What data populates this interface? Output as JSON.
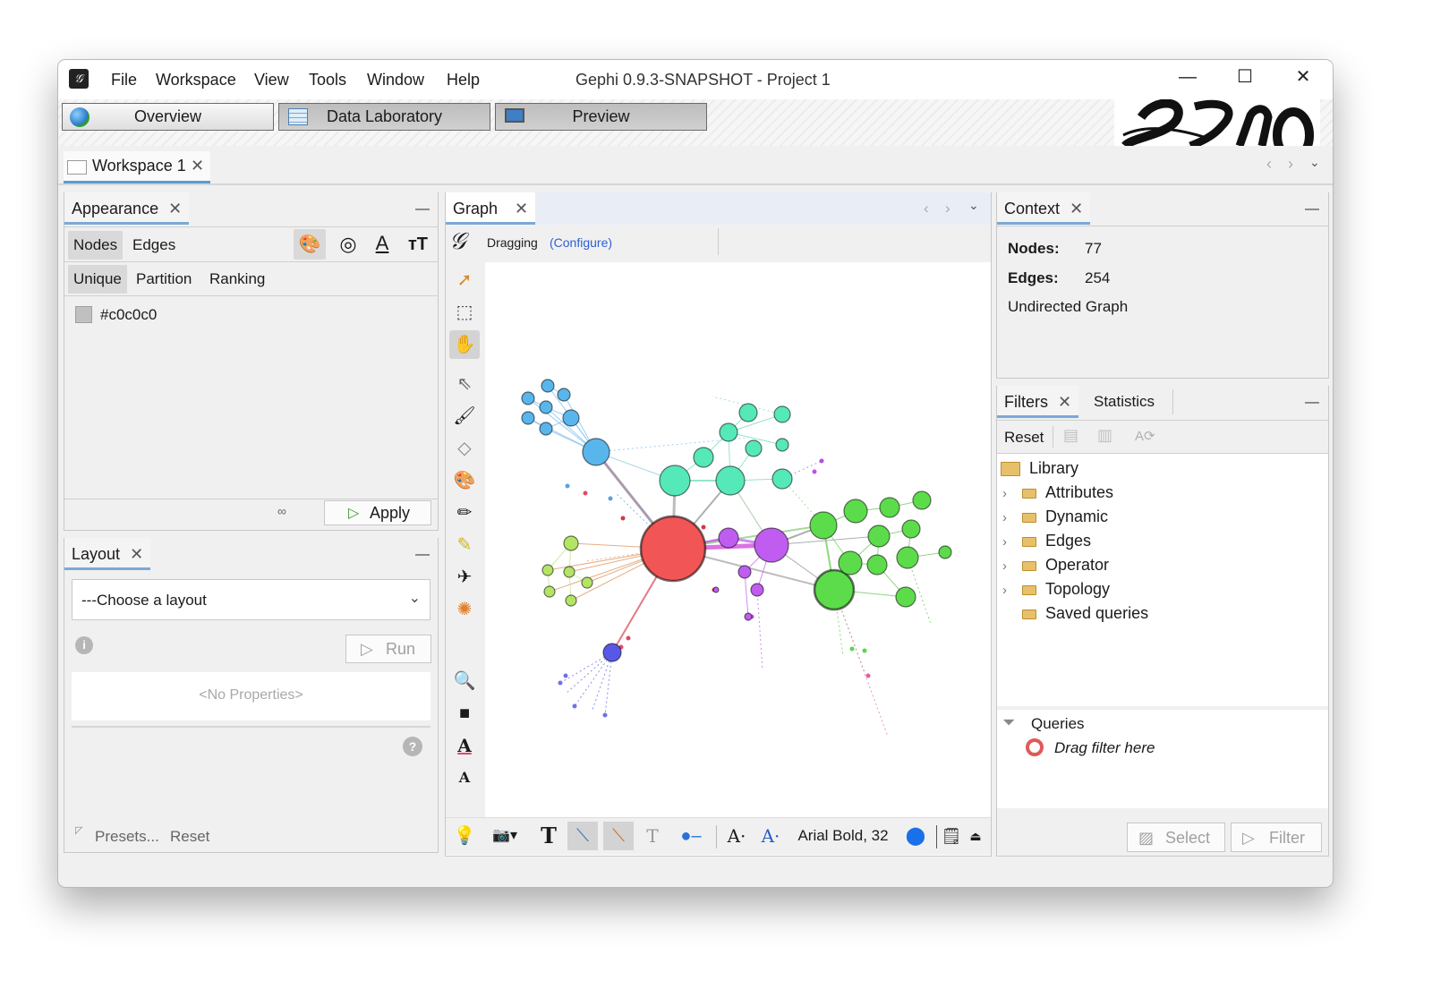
{
  "window": {
    "title": "Gephi 0.9.3-SNAPSHOT - Project 1",
    "menu": [
      "File",
      "Workspace",
      "View",
      "Tools",
      "Window",
      "Help"
    ],
    "controls": {
      "minimize": "—",
      "maximize": "☐",
      "close": "✕"
    }
  },
  "perspectives": [
    {
      "label": "Overview",
      "icon": "globe-icon",
      "selected": true
    },
    {
      "label": "Data Laboratory",
      "icon": "table-icon",
      "selected": false
    },
    {
      "label": "Preview",
      "icon": "monitor-icon",
      "selected": false
    }
  ],
  "workspace_tab": {
    "label": "Workspace 1",
    "close": "✕"
  },
  "appearance": {
    "title": "Appearance",
    "close": "✕",
    "element_tabs": [
      "Nodes",
      "Edges"
    ],
    "mode_tabs": [
      "Unique",
      "Partition",
      "Ranking"
    ],
    "color_value": "#c0c0c0",
    "apply_label": "Apply",
    "chain_icon": "∞"
  },
  "layout": {
    "title": "Layout",
    "close": "✕",
    "select_value": "---Choose a layout",
    "run_label": "Run",
    "no_properties": "<No Properties>",
    "presets_label": "Presets...",
    "reset_label": "Reset"
  },
  "graph": {
    "tab_label": "Graph",
    "close": "✕",
    "mode_label": "Dragging",
    "configure_link": "(Configure)",
    "font_label": "Arial Bold, 32",
    "edge_color": "#b0b0b0"
  },
  "context": {
    "title": "Context",
    "close": "✕",
    "nodes_label": "Nodes:",
    "nodes_value": "77",
    "edges_label": "Edges:",
    "edges_value": "254",
    "graph_type": "Undirected Graph"
  },
  "filters": {
    "tab_label": "Filters",
    "close": "✕",
    "statistics_tab": "Statistics",
    "reset_label": "Reset",
    "library_label": "Library",
    "library_items": [
      {
        "label": "Attributes",
        "expandable": true
      },
      {
        "label": "Dynamic",
        "expandable": true
      },
      {
        "label": "Edges",
        "expandable": true
      },
      {
        "label": "Operator",
        "expandable": true
      },
      {
        "label": "Topology",
        "expandable": true
      },
      {
        "label": "Saved queries",
        "expandable": false
      }
    ],
    "queries_label": "Queries",
    "drag_hint": "Drag filter here",
    "select_label": "Select",
    "filter_label": "Filter"
  },
  "colors": {
    "red": "#f25555",
    "green": "#5cdc4a",
    "teal": "#55e8b8",
    "purple": "#c05cf0",
    "blue": "#59b6ec",
    "lime": "#b4e464",
    "indigo": "#5858e8"
  }
}
